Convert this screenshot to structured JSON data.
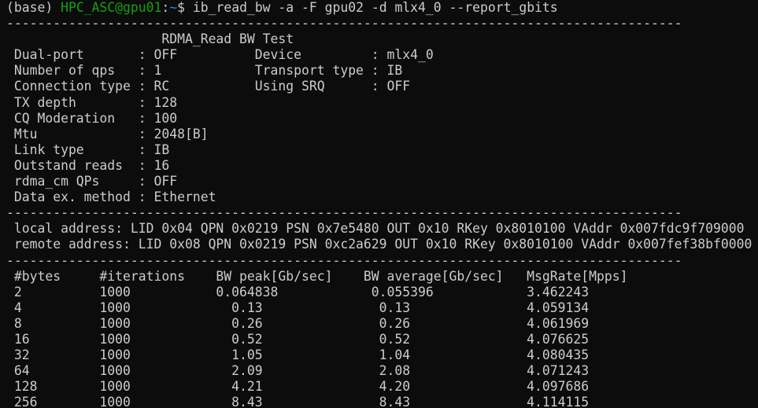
{
  "prompt": {
    "env": "(base) ",
    "user_host": "HPC_ASC@gpu01",
    "colon": ":",
    "path": "~",
    "symbol": "$ ",
    "command": "ib_read_bw -a -F gpu02 -d mlx4_0 --report_gbits"
  },
  "separator": "---------------------------------------------------------------------------------------",
  "header": {
    "title_line": "                    RDMA_Read BW Test"
  },
  "settings": [
    " Dual-port       : OFF          Device         : mlx4_0",
    " Number of qps   : 1            Transport type : IB",
    " Connection type : RC           Using SRQ      : OFF",
    " TX depth        : 128",
    " CQ Moderation   : 100",
    " Mtu             : 2048[B]",
    " Link type       : IB",
    " Outstand reads  : 16",
    " rdma_cm QPs     : OFF",
    " Data ex. method : Ethernet"
  ],
  "addresses": [
    " local address: LID 0x04 QPN 0x0219 PSN 0x7e5480 OUT 0x10 RKey 0x8010100 VAddr 0x007fdc9f709000",
    " remote address: LID 0x08 QPN 0x0219 PSN 0xc2a629 OUT 0x10 RKey 0x8010100 VAddr 0x007fef38bf0000"
  ],
  "results": {
    "header": " #bytes     #iterations    BW peak[Gb/sec]    BW average[Gb/sec]   MsgRate[Mpps]",
    "rows": [
      " 2          1000           0.064838            0.055396            3.462243",
      " 4          1000             0.13               0.13               4.059134",
      " 8          1000             0.26               0.26               4.061969",
      " 16         1000             0.52               0.52               4.076625",
      " 32         1000             1.05               1.04               4.080435",
      " 64         1000             2.09               2.08               4.071243",
      " 128        1000             4.21               4.20               4.097686",
      " 256        1000             8.43               8.43               4.114115"
    ]
  },
  "colors": {
    "background": "#0c0c0c",
    "text": "#cccccc",
    "user_host": "#13a10e",
    "path": "#3b78ff"
  }
}
